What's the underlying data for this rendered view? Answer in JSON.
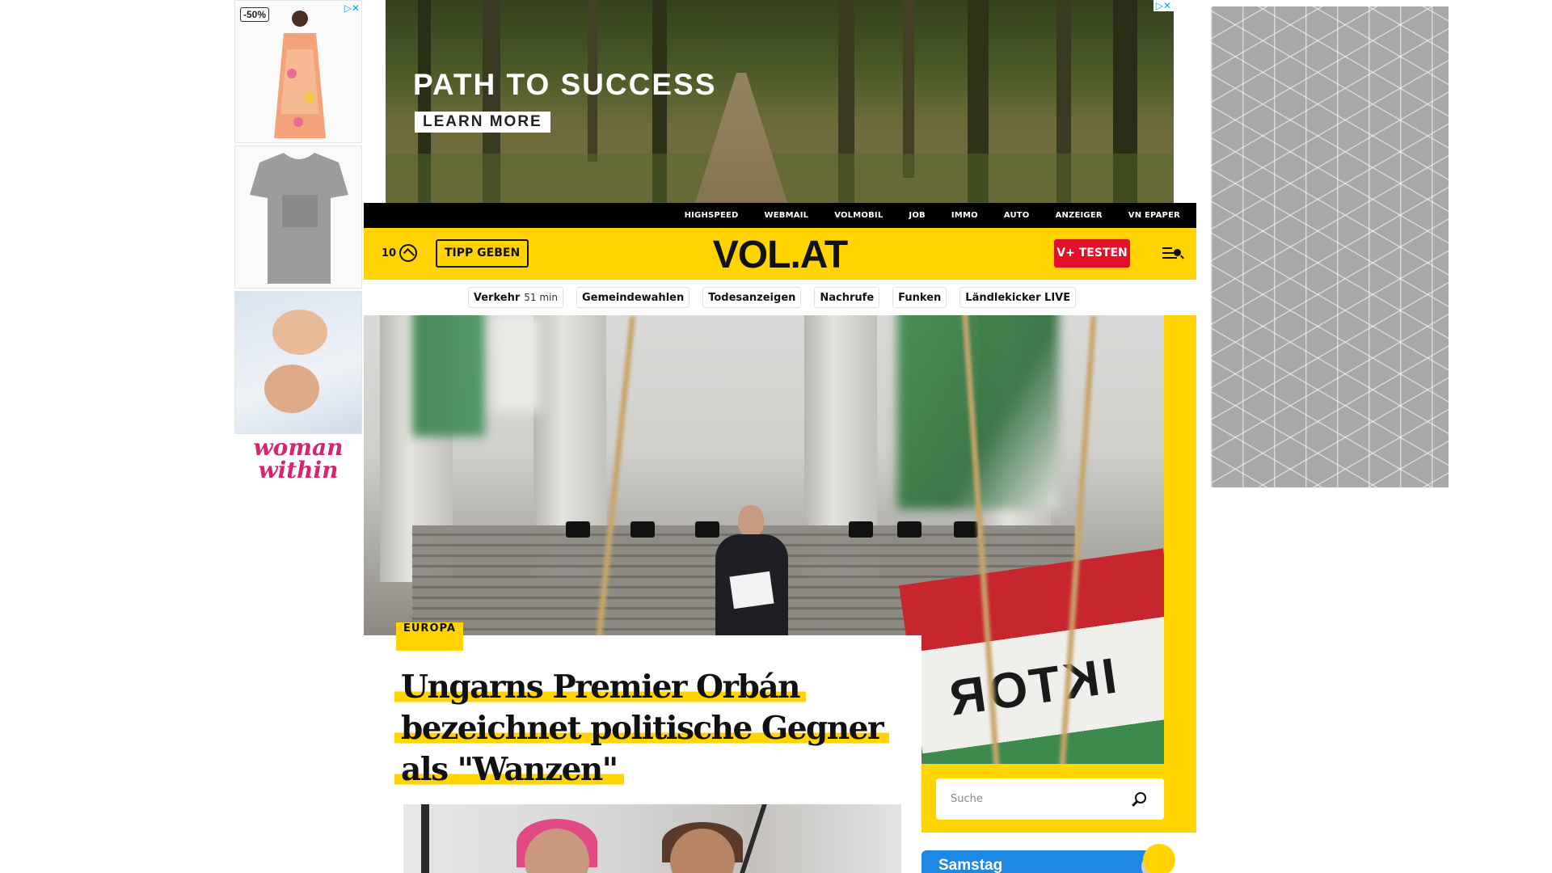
{
  "ads": {
    "left": {
      "badge": "-50%",
      "brand": "woman within",
      "adchoice_icon": "adchoices-icon"
    },
    "top": {
      "headline": "PATH TO SUCCESS",
      "cta": "LEARN MORE",
      "adchoice_icon": "adchoices-close-icon"
    }
  },
  "topbar": {
    "links": [
      "HIGHSPEED",
      "WEBMAIL",
      "VOLMOBIL",
      "JOB",
      "IMMO",
      "AUTO",
      "ANZEIGER",
      "VN EPAPER"
    ]
  },
  "header": {
    "weather_temp": "10",
    "weather_icon": "weather-icon",
    "tip_button": "TIPP GEBEN",
    "logo": "VOL.AT",
    "subscribe_button": "V+ TESTEN",
    "menu_icon": "menu-search-icon",
    "accent_color": "#ffd400",
    "subscribe_color": "#e4102a"
  },
  "quicklinks": [
    {
      "label": "Verkehr",
      "sub": "51 min"
    },
    {
      "label": "Gemeindewahlen",
      "sub": ""
    },
    {
      "label": "Todesanzeigen",
      "sub": ""
    },
    {
      "label": "Nachrufe",
      "sub": ""
    },
    {
      "label": "Funken",
      "sub": ""
    },
    {
      "label": "Ländlekicker LIVE",
      "sub": ""
    }
  ],
  "lead_article": {
    "category": "EUROPA",
    "headline": "Ungarns Premier Orbán bezeichnet politische Gegner als \"Wanzen\""
  },
  "search": {
    "placeholder": "Suche"
  },
  "weather_widget": {
    "day": "Samstag"
  }
}
